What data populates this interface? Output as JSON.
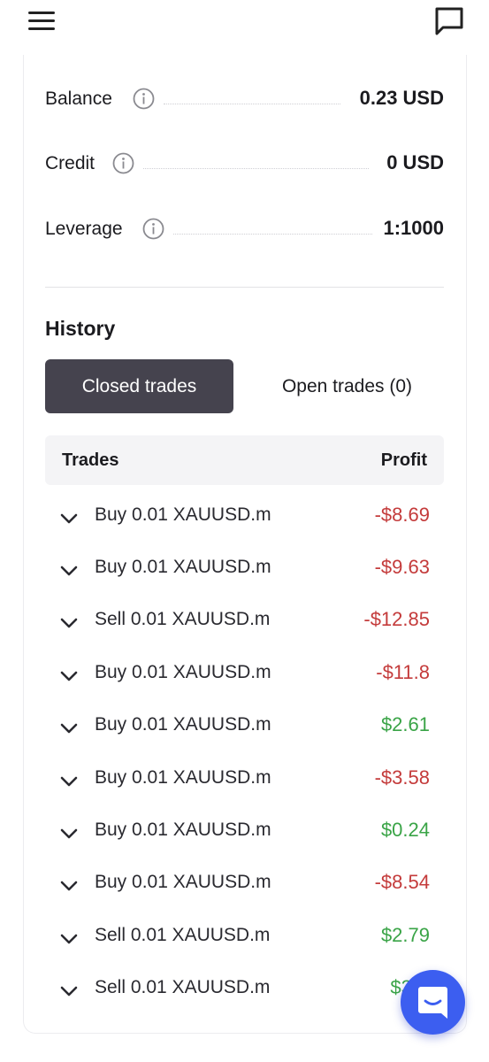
{
  "account": {
    "balance": {
      "label": "Balance",
      "value": "0.23 USD"
    },
    "credit": {
      "label": "Credit",
      "value": "0 USD"
    },
    "leverage": {
      "label": "Leverage",
      "value": "1:1000"
    }
  },
  "history": {
    "title": "History",
    "tabs": {
      "closed": "Closed trades",
      "open": "Open trades (0)"
    },
    "columns": {
      "trades": "Trades",
      "profit": "Profit"
    },
    "trades": [
      {
        "name": "Buy 0.01 XAUUSD.m",
        "profit": "-$8.69",
        "sign": "neg"
      },
      {
        "name": "Buy 0.01 XAUUSD.m",
        "profit": "-$9.63",
        "sign": "neg"
      },
      {
        "name": "Sell 0.01 XAUUSD.m",
        "profit": "-$12.85",
        "sign": "neg"
      },
      {
        "name": "Buy 0.01 XAUUSD.m",
        "profit": "-$11.8",
        "sign": "neg"
      },
      {
        "name": "Buy 0.01 XAUUSD.m",
        "profit": "$2.61",
        "sign": "pos"
      },
      {
        "name": "Buy 0.01 XAUUSD.m",
        "profit": "-$3.58",
        "sign": "neg"
      },
      {
        "name": "Buy 0.01 XAUUSD.m",
        "profit": "$0.24",
        "sign": "pos"
      },
      {
        "name": "Buy 0.01 XAUUSD.m",
        "profit": "-$8.54",
        "sign": "neg"
      },
      {
        "name": "Sell 0.01 XAUUSD.m",
        "profit": "$2.79",
        "sign": "pos"
      },
      {
        "name": "Sell 0.01 XAUUSD.m",
        "profit": "$3.",
        "sign": "pos"
      }
    ]
  },
  "icons": {
    "menu": "hamburger-menu-icon",
    "chat": "chat-bubble-icon",
    "info": "info-circle-icon",
    "expand": "chevron-down-icon",
    "support": "support-chat-icon"
  },
  "colors": {
    "active_tab": "#45434e",
    "negative": "#c43b3b",
    "positive": "#3aa447",
    "fab": "#3c5ef0"
  }
}
